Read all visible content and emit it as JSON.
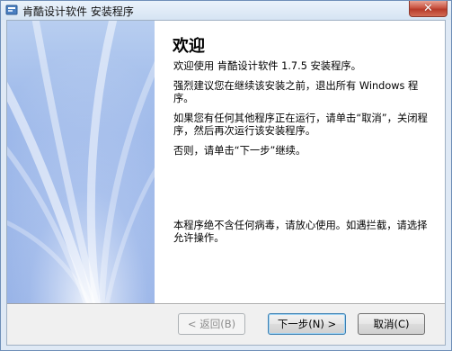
{
  "window": {
    "title": "肯酷设计软件 安装程序",
    "close_label": "✕"
  },
  "wizard": {
    "heading": "欢迎",
    "paragraphs": [
      "欢迎使用 肯酷设计软件 1.7.5 安装程序。",
      "强烈建议您在继续该安装之前，退出所有 Windows 程序。",
      "如果您有任何其他程序正在运行，请单击“取消”，关闭程序，然后再次运行该安装程序。",
      "否则，请单击“下一步”继续。",
      "本程序绝不含任何病毒，请放心使用。如遇拦截，请选择允许操作。"
    ]
  },
  "buttons": {
    "back": "< 返回(B)",
    "next": "下一步(N) >",
    "cancel": "取消(C)"
  },
  "colors": {
    "side_art_top": "#b8cef0",
    "side_art_bottom": "#7d9fe0",
    "close_button": "#c95442"
  }
}
